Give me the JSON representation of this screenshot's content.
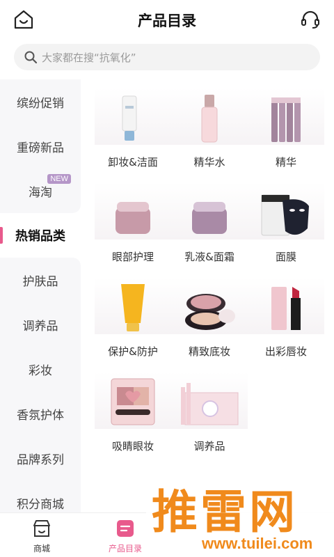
{
  "header": {
    "title": "产品目录",
    "home_icon": "home-smile-icon",
    "service_icon": "headset-icon"
  },
  "search": {
    "placeholder": "大家都在搜“抗氧化”"
  },
  "sidebar": {
    "items": [
      {
        "label": "缤纷促销"
      },
      {
        "label": "重磅新品"
      },
      {
        "label": "海淘",
        "badge": "NEW"
      },
      {
        "label": "热销品类",
        "active": true
      },
      {
        "label": "护肤品"
      },
      {
        "label": "调养品"
      },
      {
        "label": "彩妆"
      },
      {
        "label": "香氛护体"
      },
      {
        "label": "品牌系列"
      },
      {
        "label": "积分商城"
      }
    ]
  },
  "products": [
    {
      "label": "卸妆&洁面"
    },
    {
      "label": "精华水"
    },
    {
      "label": "精华"
    },
    {
      "label": "眼部护理"
    },
    {
      "label": "乳液&面霜"
    },
    {
      "label": "面膜"
    },
    {
      "label": "保护&防护"
    },
    {
      "label": "精致底妆"
    },
    {
      "label": "出彩唇妆"
    },
    {
      "label": "吸睛眼妆"
    },
    {
      "label": "调养品"
    }
  ],
  "tabbar": {
    "tabs": [
      {
        "label": "商城",
        "icon": "store-icon"
      },
      {
        "label": "产品目录",
        "icon": "catalog-icon",
        "active": true
      }
    ]
  },
  "watermark": {
    "text": "推雷网",
    "url": "www.tuilei.com"
  },
  "colors": {
    "accent": "#e85a8c",
    "sidebar_bg": "#f7f7f9",
    "search_bg": "#f3f3f3",
    "watermark": "#f08a1c"
  }
}
